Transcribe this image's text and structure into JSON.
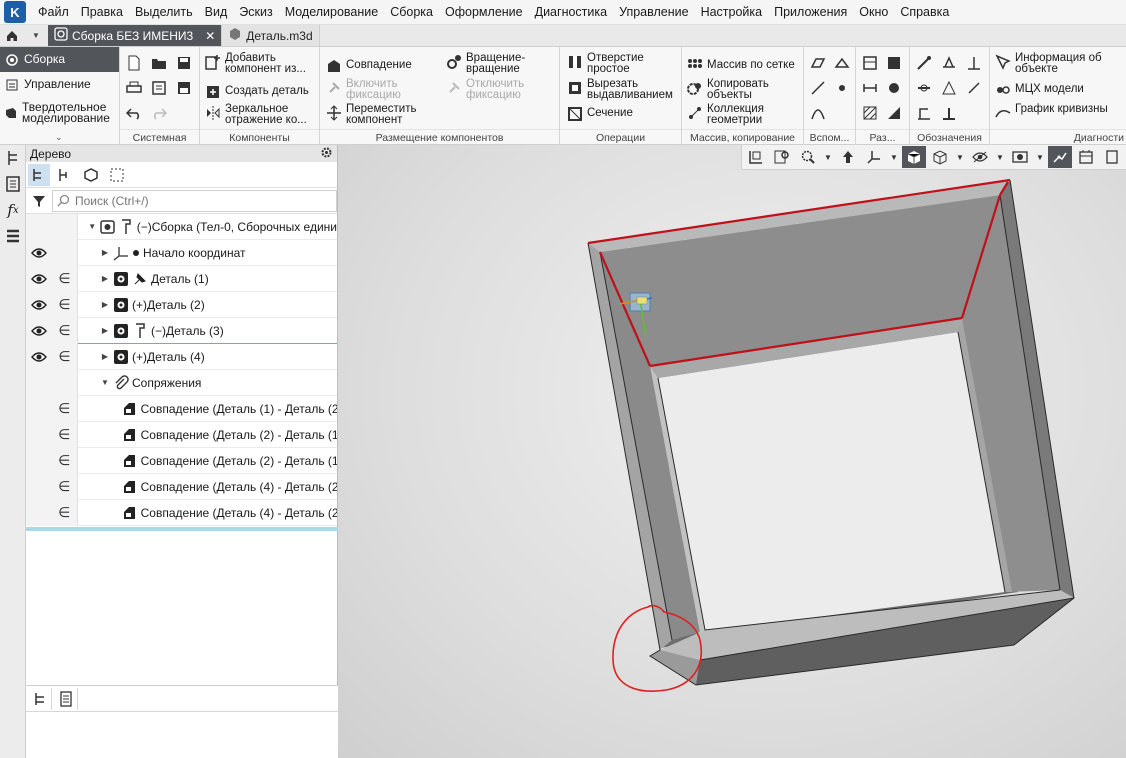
{
  "menu": [
    "Файл",
    "Правка",
    "Выделить",
    "Вид",
    "Эскиз",
    "Моделирование",
    "Сборка",
    "Оформление",
    "Диагностика",
    "Управление",
    "Настройка",
    "Приложения",
    "Окно",
    "Справка"
  ],
  "tabs": {
    "active": "Сборка БЕЗ ИМЕНИ3",
    "inactive": "Деталь.m3d"
  },
  "ribbon_left": {
    "items": [
      "Сборка",
      "Управление",
      "Твердотельное моделирование"
    ]
  },
  "ribbon": {
    "groups": [
      "Системная",
      "Компоненты",
      "Размещение компонентов",
      "Операции",
      "Массив, копирование",
      "Вспом...",
      "Раз...",
      "Обозначения",
      "Диагности"
    ],
    "components": [
      "Добавить компонент из...",
      "Создать деталь",
      "Зеркальное отражение ко..."
    ],
    "placement": [
      "Совпадение",
      "Включить фиксацию",
      "Переместить компонент",
      "Вращение-вращение",
      "Отключить фиксацию"
    ],
    "operations": [
      "Отверстие простое",
      "Вырезать выдавливанием",
      "Сечение"
    ],
    "arrays": [
      "Массив по сетке",
      "Копировать объекты",
      "Коллекция геометрии"
    ],
    "diagnostics": [
      "Информация об объекте",
      "МЦХ модели",
      "График кривизны"
    ]
  },
  "tree": {
    "title": "Дерево",
    "search_placeholder": "Поиск (Ctrl+/)",
    "root": "(−)Сборка (Тел-0, Сборочных едини",
    "origin": "Начало координат",
    "parts": [
      "Деталь (1)",
      "(+)Деталь (2)",
      "(−)Деталь (3)",
      "(+)Деталь (4)"
    ],
    "mates_header": "Сопряжения",
    "mates": [
      "Совпадение (Деталь (1)  -  Деталь (2",
      "Совпадение (Деталь (2)  -  Деталь (1",
      "Совпадение (Деталь (2)  -  Деталь (1",
      "Совпадение (Деталь (4)  -  Деталь (2",
      "Совпадение (Деталь (4)  -  Деталь (2"
    ]
  },
  "colors": {
    "accent_dark": "#52555a",
    "highlight_red": "#c0101a",
    "annotation_red": "#e02020",
    "selection_blue": "#5ab3d6"
  }
}
